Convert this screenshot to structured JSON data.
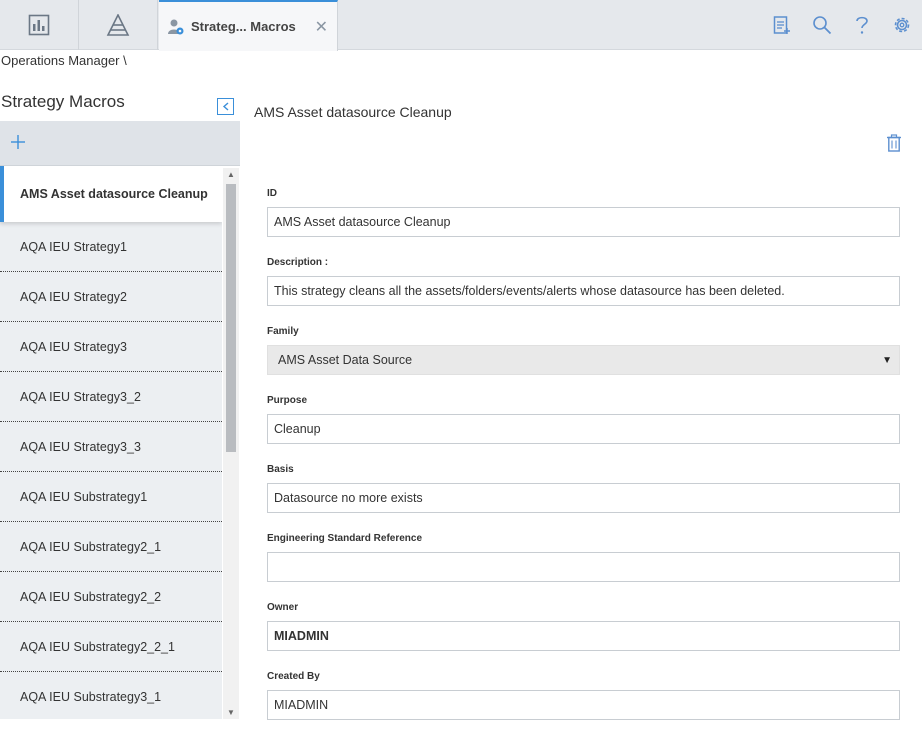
{
  "tabs": {
    "active_label": "Strateg... Macros"
  },
  "breadcrumb": "Operations Manager \\",
  "left_panel": {
    "title": "Strategy Macros",
    "items": [
      {
        "label": "AMS Asset datasource Cleanup",
        "selected": true
      },
      {
        "label": "AQA IEU Strategy1"
      },
      {
        "label": "AQA IEU Strategy2"
      },
      {
        "label": "AQA IEU Strategy3"
      },
      {
        "label": "AQA IEU Strategy3_2"
      },
      {
        "label": "AQA IEU Strategy3_3"
      },
      {
        "label": "AQA IEU Substrategy1"
      },
      {
        "label": "AQA IEU Substrategy2_1"
      },
      {
        "label": "AQA IEU Substrategy2_2"
      },
      {
        "label": "AQA IEU Substrategy2_2_1"
      },
      {
        "label": "AQA IEU Substrategy3_1"
      }
    ]
  },
  "detail": {
    "title": "AMS Asset datasource Cleanup",
    "fields": {
      "id": {
        "label": "ID",
        "value": "AMS Asset datasource Cleanup"
      },
      "description": {
        "label": "Description :",
        "value": "This strategy cleans all the assets/folders/events/alerts whose datasource has been deleted."
      },
      "family": {
        "label": "Family",
        "value": "AMS Asset Data Source"
      },
      "purpose": {
        "label": "Purpose",
        "value": "Cleanup"
      },
      "basis": {
        "label": "Basis",
        "value": "Datasource no more exists"
      },
      "eng_ref": {
        "label": "Engineering Standard Reference",
        "value": ""
      },
      "owner": {
        "label": "Owner",
        "value": "MIADMIN"
      },
      "created_by": {
        "label": "Created By",
        "value": "MIADMIN"
      }
    }
  },
  "icons": {
    "tab1": "dashboard-icon",
    "tab2": "pyramid-icon",
    "active_tab": "user-gear-icon",
    "right": [
      "clipboard-add-icon",
      "search-icon",
      "help-icon",
      "settings-icon"
    ]
  },
  "colors": {
    "accent": "#3a8fd9",
    "topbar": "#e5e8ec",
    "list_bg": "#eceff2"
  }
}
